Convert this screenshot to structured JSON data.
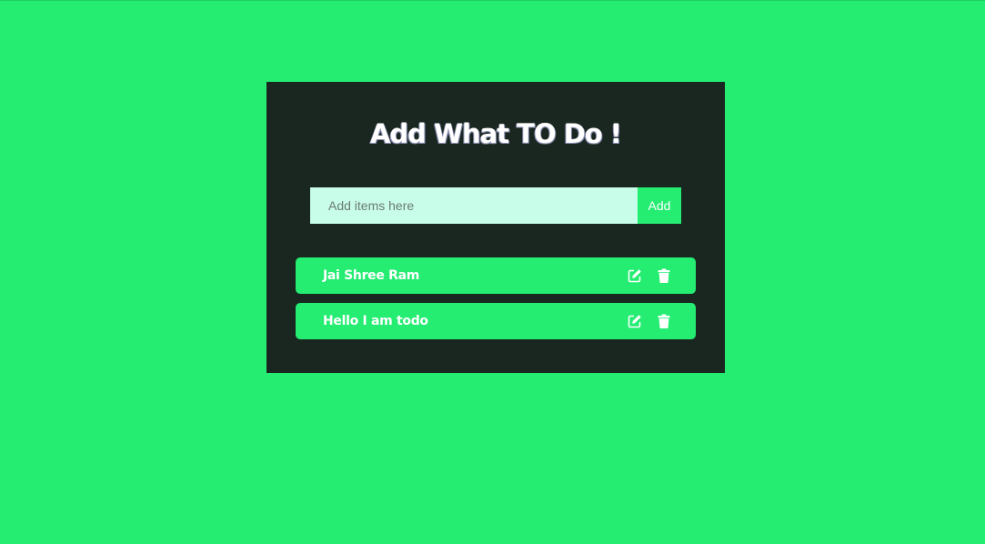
{
  "header": {
    "title": "Add What TO Do !"
  },
  "form": {
    "placeholder": "Add items here",
    "value": "",
    "add_label": "Add"
  },
  "todos": [
    {
      "text": "Jai Shree Ram",
      "edit_icon": "edit-icon",
      "delete_icon": "trash-icon"
    },
    {
      "text": "Hello I am todo",
      "edit_icon": "edit-icon",
      "delete_icon": "trash-icon"
    }
  ],
  "colors": {
    "background": "#24ed72",
    "card": "#1a2721",
    "input_bg": "#c8fde9",
    "accent": "#24ed72",
    "text": "#ffffff"
  }
}
